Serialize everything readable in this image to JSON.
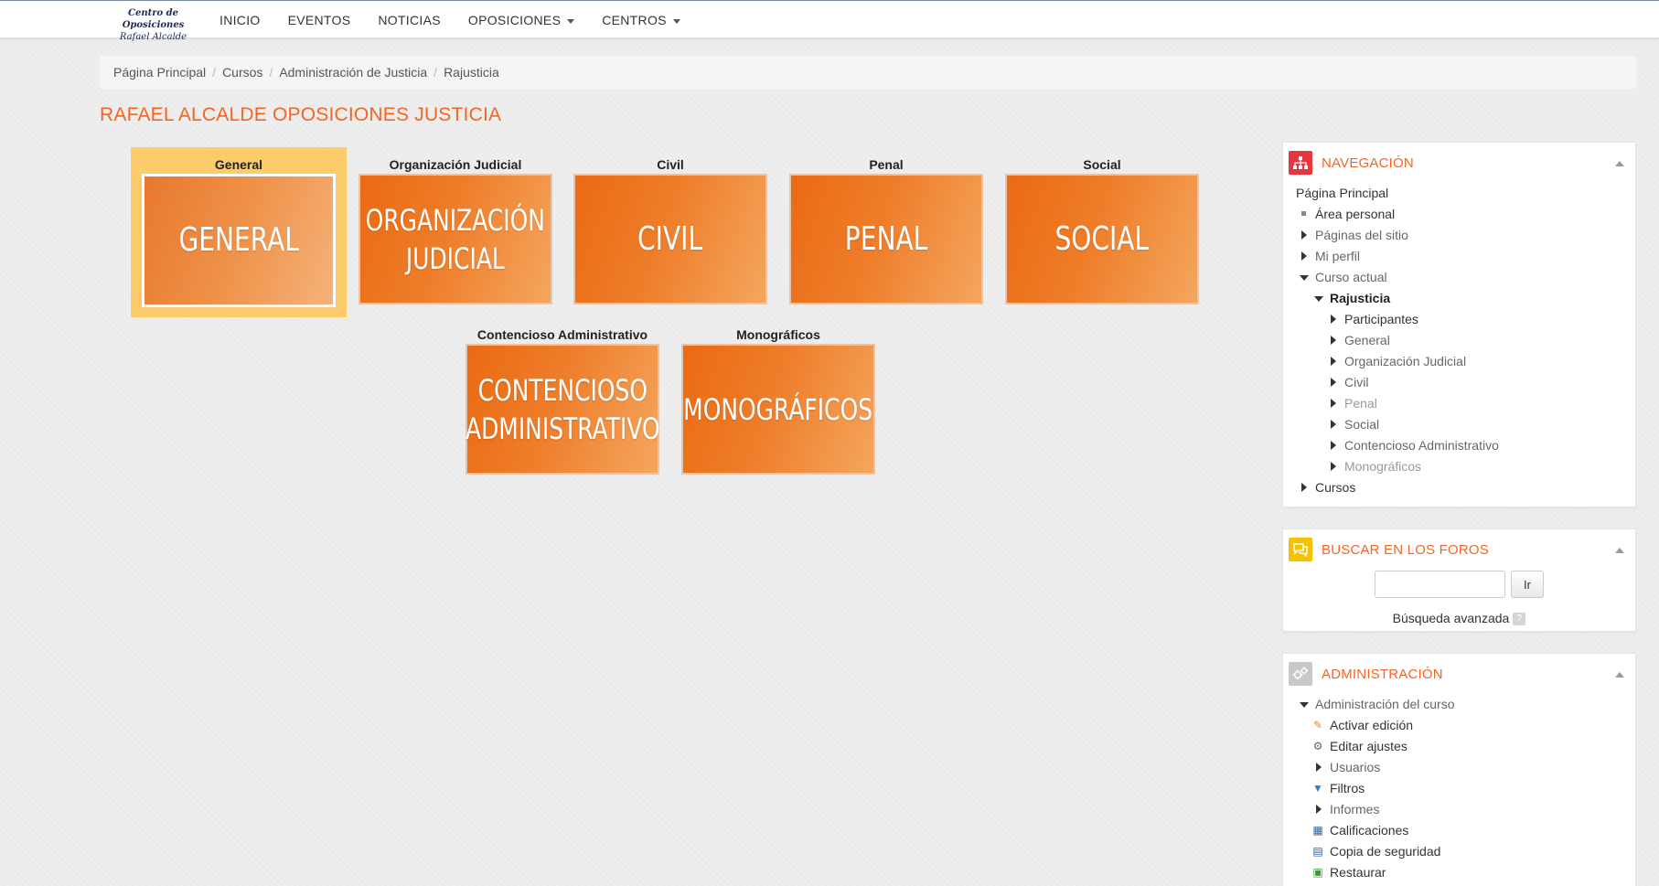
{
  "logo": {
    "line1": "Centro de Oposiciones",
    "line2": "Rafael Alcalde"
  },
  "nav": {
    "items": [
      {
        "label": "INICIO"
      },
      {
        "label": "EVENTOS"
      },
      {
        "label": "NOTICIAS"
      },
      {
        "label": "OPOSICIONES"
      },
      {
        "label": "CENTROS"
      }
    ]
  },
  "breadcrumb": [
    "Página Principal",
    "Cursos",
    "Administración de Justicia",
    "Rajusticia"
  ],
  "page_title": "RAFAEL ALCALDE OPOSICIONES JUSTICIA",
  "tiles": [
    {
      "label": "General",
      "line1": "GENERAL",
      "line2": ""
    },
    {
      "label": "Organización Judicial",
      "line1": "ORGANIZACIÓN",
      "line2": "JUDICIAL"
    },
    {
      "label": "Civil",
      "line1": "CIVIL",
      "line2": ""
    },
    {
      "label": "Penal",
      "line1": "PENAL",
      "line2": ""
    },
    {
      "label": "Social",
      "line1": "SOCIAL",
      "line2": ""
    },
    {
      "label": "Contencioso Administrativo",
      "line1": "CONTENCIOSO",
      "line2": "ADMINISTRATIVO"
    },
    {
      "label": "Monográficos",
      "line1": "MONOGRÁFICOS",
      "line2": ""
    }
  ],
  "navigation": {
    "title": "NAVEGACIÓN",
    "items": [
      "Página Principal",
      "Área personal",
      "Páginas del sitio",
      "Mi perfil",
      "Curso actual",
      "Rajusticia",
      "Participantes",
      "General",
      "Organización Judicial",
      "Civil",
      "Penal",
      "Social",
      "Contencioso Administrativo",
      "Monográficos",
      "Cursos"
    ]
  },
  "forum_search": {
    "title": "BUSCAR EN LOS FOROS",
    "input_value": "",
    "button_label": "Ir",
    "advanced_label": "Búsqueda avanzada"
  },
  "administration": {
    "title": "ADMINISTRACIÓN",
    "items": [
      "Administración del curso",
      "Activar edición",
      "Editar ajustes",
      "Usuarios",
      "Filtros",
      "Informes",
      "Calificaciones",
      "Copia de seguridad",
      "Restaurar"
    ]
  },
  "colors": {
    "accent": "#f26522",
    "tile_orange": "#eb6a12",
    "selected_bg": "#fccc6a",
    "nav_icon_bg": "#e8363e",
    "forum_icon_bg": "#f5c200",
    "admin_icon_bg": "#c8c8c8"
  }
}
